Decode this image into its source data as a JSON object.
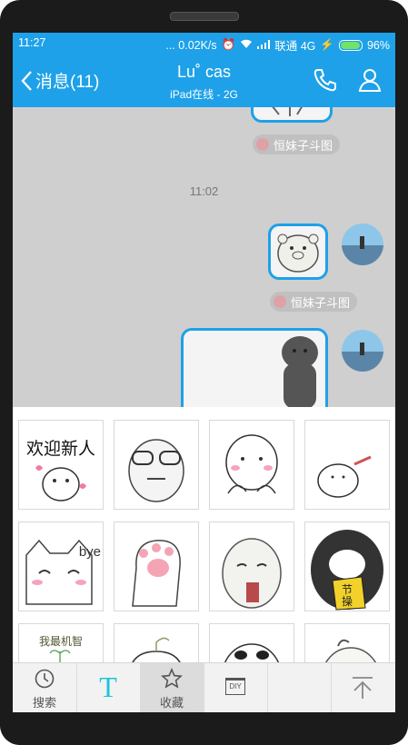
{
  "status_bar": {
    "time": "11:27",
    "network_speed": "... 0.02K/s",
    "carrier": "联通 4G",
    "battery": "96%"
  },
  "header": {
    "back_label": "消息(11)",
    "contact_name": "Lu˚ cas",
    "contact_status": "iPad在线 - 2G",
    "accent_color": "#1ea1e8"
  },
  "chat": {
    "timestamp": "11:02",
    "sticker_source_1": "恒妹子斗图",
    "sticker_source_2": "恒妹子斗图"
  },
  "sticker_grid": {
    "cells": [
      {
        "text": "欢迎新人",
        "icon": "welcome-sticker"
      },
      {
        "text": "",
        "icon": "glasses-face-sticker"
      },
      {
        "text": "",
        "icon": "shy-face-sticker"
      },
      {
        "text": "",
        "icon": "sprout-bun-sticker"
      },
      {
        "text": "bye",
        "icon": "cat-bye-sticker"
      },
      {
        "text": "",
        "icon": "paw-sticker"
      },
      {
        "text": "",
        "icon": "drinking-face-sticker"
      },
      {
        "text": "节操",
        "icon": "penguin-sticker"
      },
      {
        "text": "我最机智",
        "icon": "smart-sticker"
      },
      {
        "text": "",
        "icon": "sprout-sticker"
      },
      {
        "text": "",
        "icon": "face-sticker"
      },
      {
        "text": "",
        "icon": "rabbit-sticker"
      }
    ]
  },
  "bottom_tabs": {
    "search": "搜索",
    "text_icon": "T",
    "favorites": "收藏",
    "diy": "DIY"
  }
}
